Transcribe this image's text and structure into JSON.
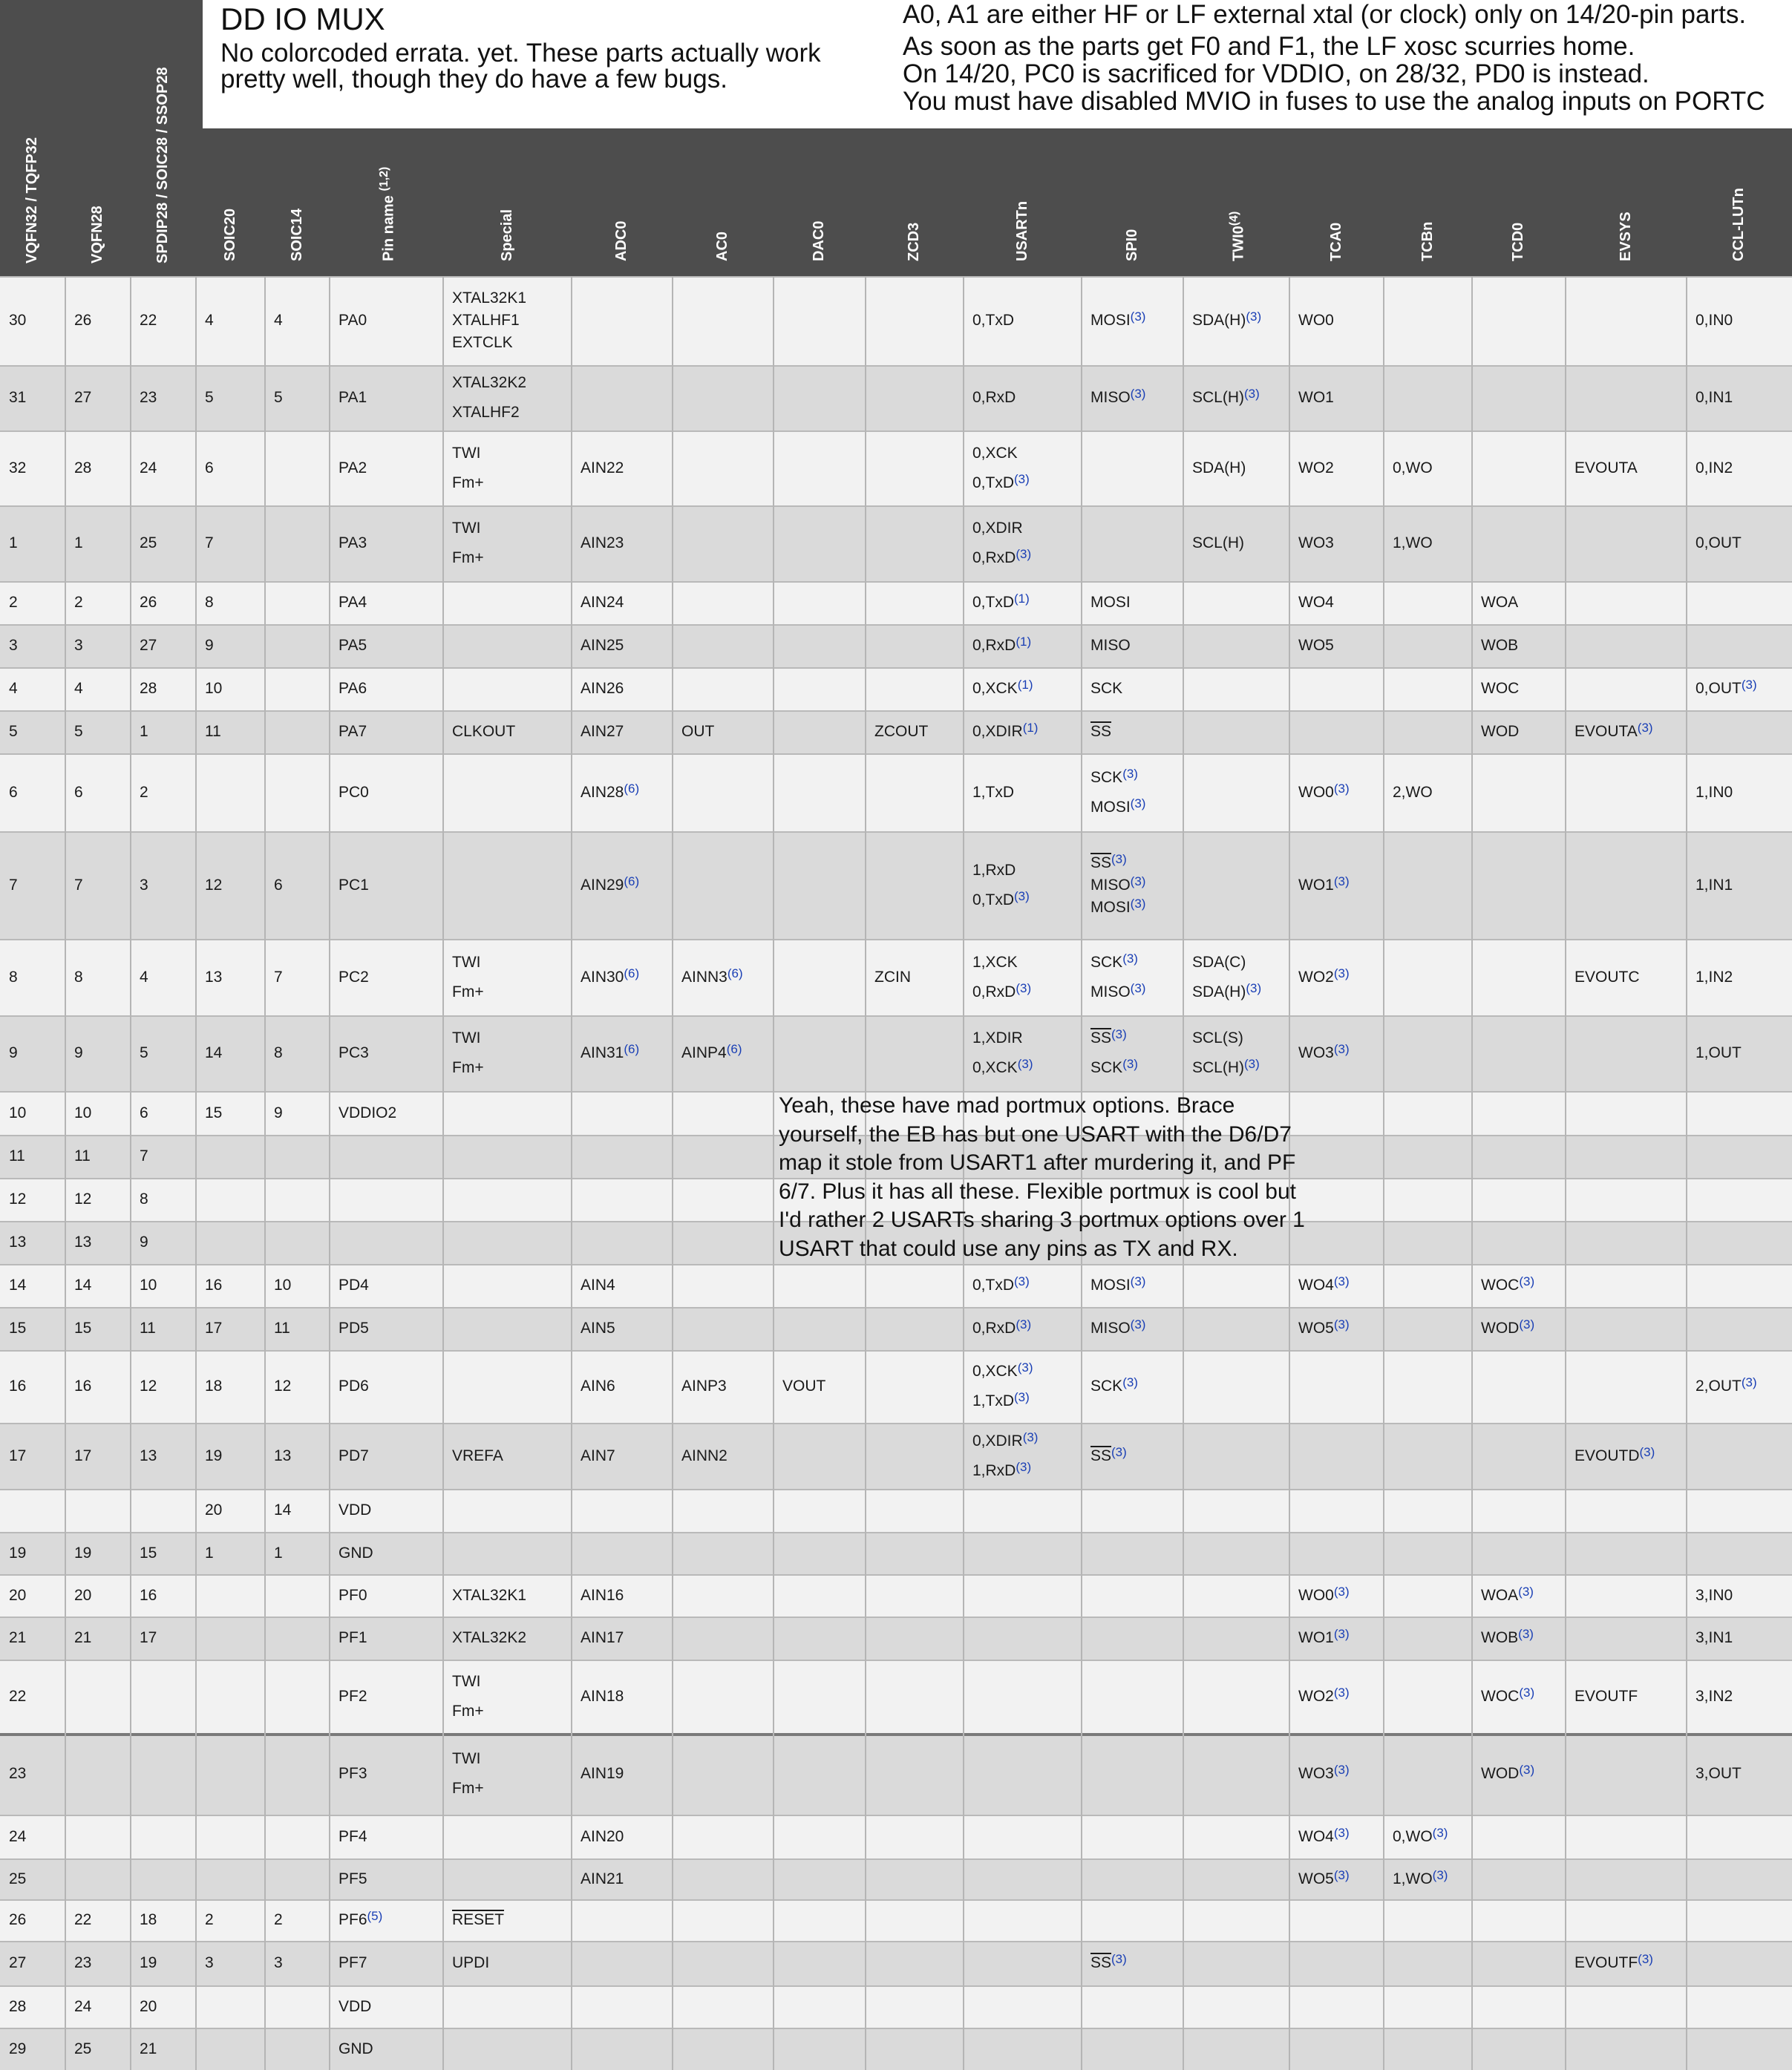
{
  "header": {
    "title": "DD IO MUX",
    "subtitle_lines": [
      "No colorcoded errata. yet. These parts actually work",
      "pretty well, though they do have a few bugs."
    ],
    "note_lines": [
      "A0, A1 are either HF or LF external xtal (or clock) only on 14/20-pin parts.",
      "As soon as the parts get F0 and F1, the LF xosc  scurries home.",
      "On 14/20, PC0 is sacrificed for VDDIO, on 28/32, PD0 is instead.",
      "You must have disabled MVIO in fuses to use the analog inputs on PORTC"
    ]
  },
  "columns": [
    {
      "key": "vqfn32",
      "label": "VQFN32 / TQFP32"
    },
    {
      "key": "vqfn28",
      "label": "VQFN28"
    },
    {
      "key": "spdip28",
      "label": "SPDIP28 / SOIC28 / SSOP28"
    },
    {
      "key": "soic20",
      "label": "SOIC20"
    },
    {
      "key": "soic14",
      "label": "SOIC14"
    },
    {
      "key": "pin",
      "label": "Pin name (1,2)"
    },
    {
      "key": "special",
      "label": "Special"
    },
    {
      "key": "adc0",
      "label": "ADC0"
    },
    {
      "key": "ac0",
      "label": "AC0"
    },
    {
      "key": "dac0",
      "label": "DAC0"
    },
    {
      "key": "zcd3",
      "label": "ZCD3"
    },
    {
      "key": "usart",
      "label": "USARTn"
    },
    {
      "key": "spi0",
      "label": "SPI0"
    },
    {
      "key": "twi0",
      "label": "TWI0(4)"
    },
    {
      "key": "tca0",
      "label": "TCA0"
    },
    {
      "key": "tcb",
      "label": "TCBn"
    },
    {
      "key": "tcd0",
      "label": "TCD0"
    },
    {
      "key": "evsys",
      "label": "EVSYS"
    },
    {
      "key": "ccl",
      "label": "CCL-LUTn"
    }
  ],
  "rows": [
    {
      "vqfn32": "30",
      "vqfn28": "26",
      "spdip28": "22",
      "soic20": "4",
      "soic14": "4",
      "pin": "PA0",
      "special": "XTAL32K1\nXTALHF1\nEXTCLK",
      "usart": "0,TxD",
      "spi0": "MOSI(3)",
      "twi0": "SDA(H)(3)",
      "tca0": "WO0",
      "ccl": "0,IN0"
    },
    {
      "vqfn32": "31",
      "vqfn28": "27",
      "spdip28": "23",
      "soic20": "5",
      "soic14": "5",
      "pin": "PA1",
      "special": "XTAL32K2\nXTALHF2",
      "usart": "0,RxD",
      "spi0": "MISO(3)",
      "twi0": "SCL(H)(3)",
      "tca0": "WO1",
      "ccl": "0,IN1"
    },
    {
      "vqfn32": "32",
      "vqfn28": "28",
      "spdip28": "24",
      "soic20": "6",
      "pin": "PA2",
      "special": "TWI\nFm+",
      "adc0": "AIN22",
      "usart": "0,XCK\n0,TxD(3)",
      "twi0": "SDA(H)",
      "tca0": "WO2",
      "tcb": "0,WO",
      "evsys": "EVOUTA",
      "ccl": "0,IN2"
    },
    {
      "vqfn32": "1",
      "vqfn28": "1",
      "spdip28": "25",
      "soic20": "7",
      "pin": "PA3",
      "special": "TWI\nFm+",
      "adc0": "AIN23",
      "usart": "0,XDIR\n0,RxD(3)",
      "twi0": "SCL(H)",
      "tca0": "WO3",
      "tcb": "1,WO",
      "ccl": "0,OUT"
    },
    {
      "vqfn32": "2",
      "vqfn28": "2",
      "spdip28": "26",
      "soic20": "8",
      "pin": "PA4",
      "adc0": "AIN24",
      "usart": "0,TxD(1)",
      "spi0": "MOSI",
      "tca0": "WO4",
      "tcd0": "WOA"
    },
    {
      "vqfn32": "3",
      "vqfn28": "3",
      "spdip28": "27",
      "soic20": "9",
      "pin": "PA5",
      "adc0": "AIN25",
      "usart": "0,RxD(1)",
      "spi0": "MISO",
      "tca0": "WO5",
      "tcd0": "WOB"
    },
    {
      "vqfn32": "4",
      "vqfn28": "4",
      "spdip28": "28",
      "soic20": "10",
      "pin": "PA6",
      "adc0": "AIN26",
      "usart": "0,XCK(1)",
      "spi0": "SCK",
      "tcd0": "WOC",
      "ccl": "0,OUT(3)"
    },
    {
      "vqfn32": "5",
      "vqfn28": "5",
      "spdip28": "1",
      "soic20": "11",
      "pin": "PA7",
      "special": "CLKOUT",
      "adc0": "AIN27",
      "ac0": "OUT",
      "zcd3": "ZCOUT",
      "usart": "0,XDIR(1)",
      "spi0": "~SS",
      "tcd0": "WOD",
      "evsys": "EVOUTA(3)"
    },
    {
      "vqfn32": "6",
      "vqfn28": "6",
      "spdip28": "2",
      "pin": "PC0",
      "adc0": "AIN28(6)",
      "usart": "1,TxD",
      "spi0": "SCK(3)\nMOSI(3)",
      "tca0": "WO0(3)",
      "tcb": "2,WO",
      "ccl": "1,IN0"
    },
    {
      "vqfn32": "7",
      "vqfn28": "7",
      "spdip28": "3",
      "soic20": "12",
      "soic14": "6",
      "pin": "PC1",
      "adc0": "AIN29(6)",
      "usart": "1,RxD\n0,TxD(3)",
      "spi0": "~SS(3)\nMISO(3)\nMOSI(3)",
      "tca0": "WO1(3)",
      "ccl": "1,IN1"
    },
    {
      "vqfn32": "8",
      "vqfn28": "8",
      "spdip28": "4",
      "soic20": "13",
      "soic14": "7",
      "pin": "PC2",
      "special": "TWI\nFm+",
      "adc0": "AIN30(6)",
      "ac0": "AINN3(6)",
      "zcd3": "ZCIN",
      "usart": "1,XCK\n0,RxD(3)",
      "spi0": "SCK(3)\nMISO(3)",
      "twi0": "SDA(C)\nSDA(H)(3)",
      "tca0": "WO2(3)",
      "evsys": "EVOUTC",
      "ccl": "1,IN2"
    },
    {
      "vqfn32": "9",
      "vqfn28": "9",
      "spdip28": "5",
      "soic20": "14",
      "soic14": "8",
      "pin": "PC3",
      "special": "TWI\nFm+",
      "adc0": "AIN31(6)",
      "ac0": "AINP4(6)",
      "usart": "1,XDIR\n0,XCK(3)",
      "spi0": "~SS(3)\nSCK(3)",
      "twi0": "SCL(S)\nSCL(H)(3)",
      "tca0": "WO3(3)",
      "ccl": "1,OUT"
    },
    {
      "vqfn32": "10",
      "vqfn28": "10",
      "spdip28": "6",
      "soic20": "15",
      "soic14": "9",
      "pin": "VDDIO2"
    },
    {
      "vqfn32": "11",
      "vqfn28": "11",
      "spdip28": "7"
    },
    {
      "vqfn32": "12",
      "vqfn28": "12",
      "spdip28": "8"
    },
    {
      "vqfn32": "13",
      "vqfn28": "13",
      "spdip28": "9"
    },
    {
      "vqfn32": "14",
      "vqfn28": "14",
      "spdip28": "10",
      "soic20": "16",
      "soic14": "10",
      "pin": "PD4",
      "adc0": "AIN4",
      "usart": "0,TxD(3)",
      "spi0": "MOSI(3)",
      "tca0": "WO4(3)",
      "tcd0": "WOC(3)"
    },
    {
      "vqfn32": "15",
      "vqfn28": "15",
      "spdip28": "11",
      "soic20": "17",
      "soic14": "11",
      "pin": "PD5",
      "adc0": "AIN5",
      "usart": "0,RxD(3)",
      "spi0": "MISO(3)",
      "tca0": "WO5(3)",
      "tcd0": "WOD(3)"
    },
    {
      "vqfn32": "16",
      "vqfn28": "16",
      "spdip28": "12",
      "soic20": "18",
      "soic14": "12",
      "pin": "PD6",
      "adc0": "AIN6",
      "ac0": "AINP3",
      "dac0": "VOUT",
      "usart": "0,XCK(3)\n1,TxD(3)",
      "spi0": "SCK(3)",
      "ccl": "2,OUT(3)"
    },
    {
      "vqfn32": "17",
      "vqfn28": "17",
      "spdip28": "13",
      "soic20": "19",
      "soic14": "13",
      "pin": "PD7",
      "special": "VREFA",
      "adc0": "AIN7",
      "ac0": "AINN2",
      "usart": "0,XDIR(3)\n1,RxD(3)",
      "spi0": "~SS(3)",
      "evsys": "EVOUTD(3)"
    },
    {
      "soic20": "20",
      "soic14": "14",
      "pin": "VDD"
    },
    {
      "vqfn32": "19",
      "vqfn28": "19",
      "spdip28": "15",
      "soic20": "1",
      "soic14": "1",
      "pin": "GND"
    },
    {
      "vqfn32": "20",
      "vqfn28": "20",
      "spdip28": "16",
      "pin": "PF0",
      "special": "XTAL32K1",
      "adc0": "AIN16",
      "tca0": "WO0(3)",
      "tcd0": "WOA(3)",
      "ccl": "3,IN0"
    },
    {
      "vqfn32": "21",
      "vqfn28": "21",
      "spdip28": "17",
      "pin": "PF1",
      "special": "XTAL32K2",
      "adc0": "AIN17",
      "tca0": "WO1(3)",
      "tcd0": "WOB(3)",
      "ccl": "3,IN1"
    },
    {
      "vqfn32": "22",
      "pin": "PF2",
      "special": "TWI\nFm+",
      "adc0": "AIN18",
      "tca0": "WO2(3)",
      "tcd0": "WOC(3)",
      "evsys": "EVOUTF",
      "ccl": "3,IN2"
    },
    {
      "vqfn32": "23",
      "pin": "PF3",
      "special": "TWI\nFm+",
      "adc0": "AIN19",
      "tca0": "WO3(3)",
      "tcd0": "WOD(3)",
      "ccl": "3,OUT"
    },
    {
      "vqfn32": "24",
      "pin": "PF4",
      "adc0": "AIN20",
      "tca0": "WO4(3)",
      "tcb": "0,WO(3)"
    },
    {
      "vqfn32": "25",
      "pin": "PF5",
      "adc0": "AIN21",
      "tca0": "WO5(3)",
      "tcb": "1,WO(3)"
    },
    {
      "vqfn32": "26",
      "vqfn28": "22",
      "spdip28": "18",
      "soic20": "2",
      "soic14": "2",
      "pin": "PF6(5)",
      "special": "~RESET"
    },
    {
      "vqfn32": "27",
      "vqfn28": "23",
      "spdip28": "19",
      "soic20": "3",
      "soic14": "3",
      "pin": "PF7",
      "special": "UPDI",
      "spi0": "~SS(3)",
      "evsys": "EVOUTF(3)"
    },
    {
      "vqfn32": "28",
      "vqfn28": "24",
      "spdip28": "20",
      "pin": "VDD"
    },
    {
      "vqfn32": "29",
      "vqfn28": "25",
      "spdip28": "21",
      "pin": "GND"
    }
  ],
  "portmux_note": "Yeah, these have mad portmux options. Brace\nyourself, the EB has but one USART with the D6/D7\nmap it stole from USART1 after murdering it, and PF\n6/7. Plus it has all these. Flexible portmux is cool but\nI'd rather 2 USARTs sharing 3 portmux options over 1\nUSART that could use any pins as TX and RX.",
  "colors": {
    "header_bg": "#4d4d4d",
    "row_light": "#f2f2f2",
    "row_dark": "#dadada",
    "footnote": "#1a3fb5"
  }
}
